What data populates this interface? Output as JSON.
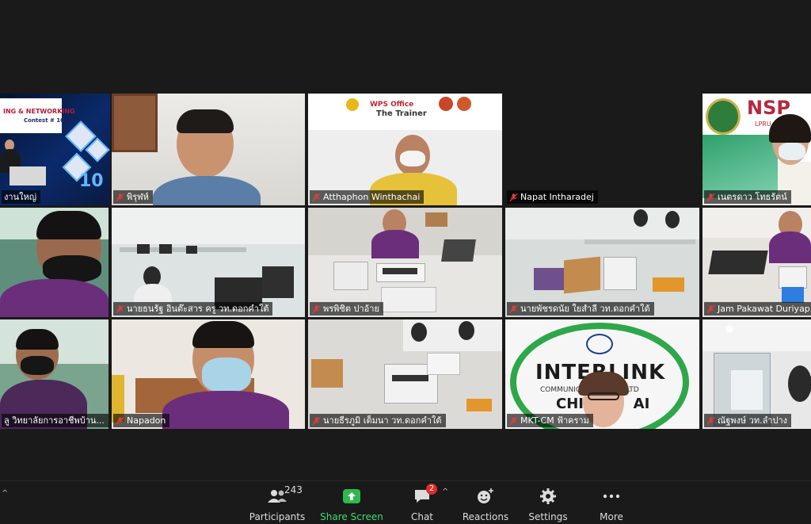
{
  "participants": [
    {
      "name": "งานใหญ่",
      "muted": false
    },
    {
      "name": "พิรุฬห์",
      "muted": true
    },
    {
      "name": "Atthaphon Winthachai",
      "muted": true
    },
    {
      "name": "Napat Intharadej",
      "muted": true
    },
    {
      "name": "เนตรดาว โทธรัตน์",
      "muted": true
    },
    {
      "name": "",
      "muted": false
    },
    {
      "name": "นายธนรัฐ อินต๊ะสาร ครู วท.ดอกคำใต้",
      "muted": true
    },
    {
      "name": "พรพิชิต ปาอ้าย",
      "muted": true
    },
    {
      "name": "นายพัชรดนัย ใยสำลี วท.ดอกคำใต้",
      "muted": true
    },
    {
      "name": "Jam Pakawat Duriyap",
      "muted": true
    },
    {
      "name": "ลู วิทยาลัยการอาชีพบ้าน...",
      "muted": false
    },
    {
      "name": "Napadon",
      "muted": true
    },
    {
      "name": "นายธีรภูมิ เต็มนา วท.ดอกคำใต้",
      "muted": true
    },
    {
      "name": "MKT-CM ฟ้าคราม",
      "muted": true
    },
    {
      "name": "ณัฐพงษ์ วท.ลำปาง",
      "muted": true
    }
  ],
  "slides": {
    "networking_title": "ING & NETWORKING",
    "contest": "Contest # 10",
    "big_number": "10",
    "wps_brand": "WPS Office",
    "wps_sub": "The Trainer",
    "nsp_logo": "NSP",
    "nsp_sub": "LPRU",
    "interlink": "INTERLINK",
    "interlink_sub": "COMMUNICA         C CO LTD",
    "interlink_city": "CHI          AI"
  },
  "toolbar": {
    "participants_label": "Participants",
    "participants_count": "243",
    "share_label": "Share Screen",
    "chat_label": "Chat",
    "chat_badge": "2",
    "reactions_label": "Reactions",
    "settings_label": "Settings",
    "more_label": "More"
  },
  "colors": {
    "active_speaker": "#d6e24d",
    "share_green": "#3ddc6c",
    "badge_red": "#e02b2b",
    "mic_muted": "#e23b3b"
  }
}
